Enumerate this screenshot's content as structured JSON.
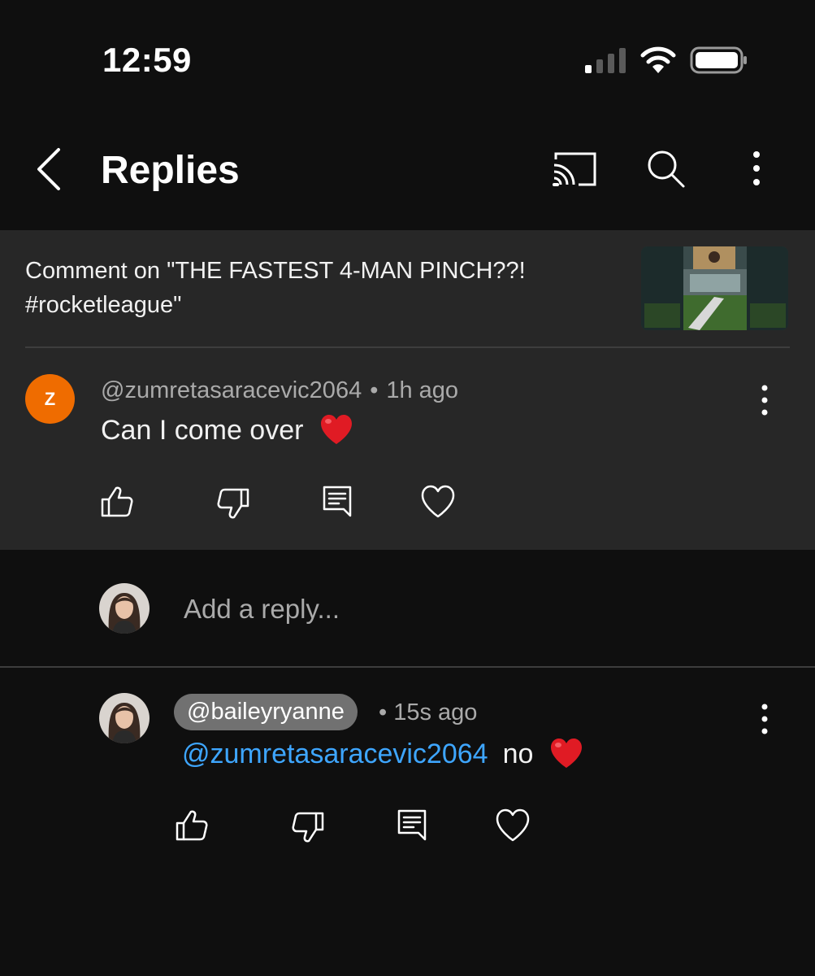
{
  "status_bar": {
    "time": "12:59",
    "icons": [
      "signal-icon",
      "wifi-icon",
      "battery-icon"
    ]
  },
  "header": {
    "title": "Replies",
    "icons": [
      "back-icon",
      "cast-icon",
      "search-icon",
      "more-vertical-icon"
    ]
  },
  "video": {
    "context_line1": "Comment on \"THE FASTEST 4-MAN PINCH??!",
    "context_line2": "#rocketleague\""
  },
  "comment": {
    "avatar_letter": "Z",
    "avatar_color": "#ef6c00",
    "author": "@zumretasaracevic2064",
    "separator": "•",
    "time": "1h ago",
    "text": "Can I come over",
    "emoji": "❤️",
    "actions": [
      "like-icon",
      "dislike-icon",
      "reply-icon",
      "heart-icon"
    ]
  },
  "reply_box": {
    "placeholder": "Add a reply..."
  },
  "reply": {
    "author": "@baileyryanne",
    "separator": "•",
    "time": "15s ago",
    "mention": "@zumretasaracevic2064",
    "text": "no",
    "emoji": "❤️",
    "mention_color": "#3ea6ff",
    "actions": [
      "like-icon",
      "dislike-icon",
      "reply-icon",
      "heart-icon"
    ]
  },
  "colors": {
    "background": "#0f0f0f",
    "card": "#272727",
    "secondary_text": "#aaaaaa",
    "heart": "#e01b24"
  }
}
